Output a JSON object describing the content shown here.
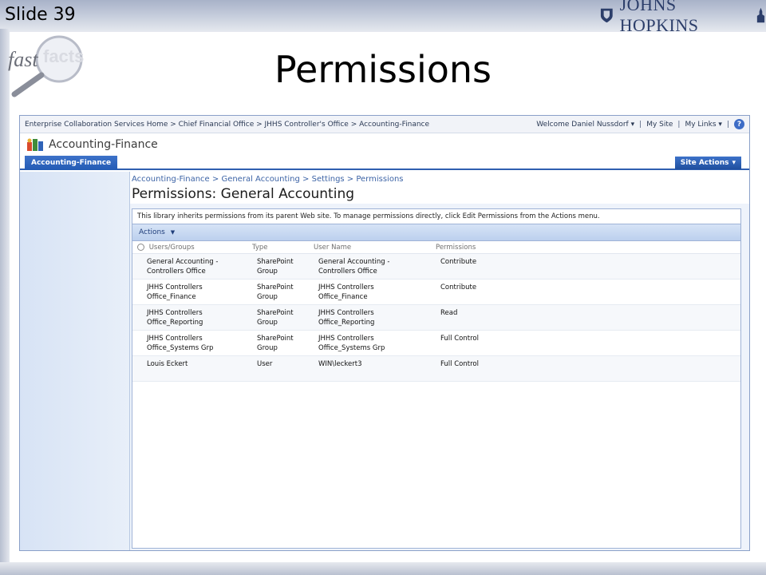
{
  "slide": {
    "number_label": "Slide 39",
    "logo_text": "JOHNS HOPKINS",
    "badge": {
      "fast": "fast",
      "facts": "facts"
    },
    "title": "Permissions"
  },
  "topbar": {
    "breadcrumb": "Enterprise Collaboration Services Home > Chief Financial Office > JHHS Controller's Office > Accounting-Finance",
    "welcome": "Welcome Daniel Nussdorf",
    "my_site": "My Site",
    "my_links": "My Links",
    "separator": "|",
    "help_glyph": "?"
  },
  "site": {
    "title": "Accounting-Finance",
    "active_tab": "Accounting-Finance",
    "site_actions": "Site Actions"
  },
  "content": {
    "breadcrumb": "Accounting-Finance > General Accounting > Settings > Permissions",
    "page_heading": "Permissions: General Accounting",
    "notice": "This library inherits permissions from its parent Web site. To manage permissions directly, click Edit Permissions from the Actions menu.",
    "actions_label": "Actions",
    "columns": {
      "users_groups": "Users/Groups",
      "type": "Type",
      "user_name": "User Name",
      "permissions": "Permissions"
    },
    "rows": [
      {
        "name": "General Accounting -\nControllers Office",
        "type": "SharePoint\nGroup",
        "user_name": "General Accounting -\nControllers Office",
        "permission": "Contribute"
      },
      {
        "name": "JHHS Controllers\nOffice_Finance",
        "type": "SharePoint\nGroup",
        "user_name": "JHHS Controllers\nOffice_Finance",
        "permission": "Contribute"
      },
      {
        "name": "JHHS Controllers\nOffice_Reporting",
        "type": "SharePoint\nGroup",
        "user_name": "JHHS Controllers\nOffice_Reporting",
        "permission": "Read"
      },
      {
        "name": "JHHS Controllers\nOffice_Systems Grp",
        "type": "SharePoint\nGroup",
        "user_name": "JHHS Controllers\nOffice_Systems Grp",
        "permission": "Full Control"
      },
      {
        "name": "Louis Eckert",
        "type": "User",
        "user_name": "WIN\\leckert3",
        "permission": "Full Control"
      }
    ]
  },
  "colors": {
    "accent_blue": "#2f5fb0",
    "link_blue": "#3d64a6",
    "toolbar_blue": "#bcd0ee"
  },
  "icons": {
    "help": "help-icon",
    "site": "site-logo-icon",
    "dropdown": "chevron-down-icon",
    "radio": "radio-icon",
    "magnifier": "magnifier-icon"
  }
}
